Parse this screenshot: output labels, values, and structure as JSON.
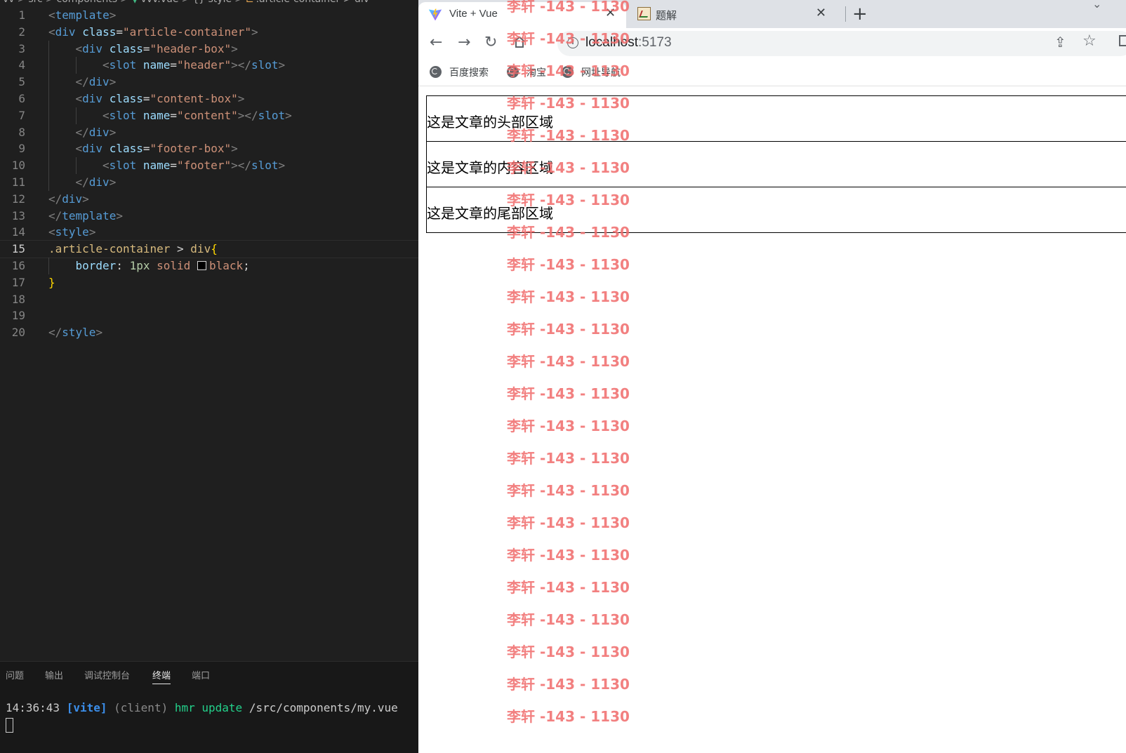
{
  "editor": {
    "breadcrumb": [
      "vv",
      "src",
      "components",
      "vvv.vue",
      "{} style",
      ".article-container > div"
    ],
    "lines": [
      {
        "n": "1",
        "indent": 0,
        "tokens": [
          [
            "t-brk",
            "<"
          ],
          [
            "t-tag",
            "template"
          ],
          [
            "t-brk",
            ">"
          ]
        ]
      },
      {
        "n": "2",
        "indent": 0,
        "tokens": [
          [
            "t-brk",
            "<"
          ],
          [
            "t-tag",
            "div"
          ],
          [
            "t-plain",
            " "
          ],
          [
            "t-attr",
            "class"
          ],
          [
            "t-plain",
            "="
          ],
          [
            "t-str",
            "\"article-container\""
          ],
          [
            "t-brk",
            ">"
          ]
        ]
      },
      {
        "n": "3",
        "indent": 1,
        "tokens": [
          [
            "t-brk",
            "<"
          ],
          [
            "t-tag",
            "div"
          ],
          [
            "t-plain",
            " "
          ],
          [
            "t-attr",
            "class"
          ],
          [
            "t-plain",
            "="
          ],
          [
            "t-str",
            "\"header-box\""
          ],
          [
            "t-brk",
            ">"
          ]
        ]
      },
      {
        "n": "4",
        "indent": 2,
        "tokens": [
          [
            "t-brk",
            "<"
          ],
          [
            "t-tag",
            "slot"
          ],
          [
            "t-plain",
            " "
          ],
          [
            "t-attr",
            "name"
          ],
          [
            "t-plain",
            "="
          ],
          [
            "t-str",
            "\"header\""
          ],
          [
            "t-brk",
            "></"
          ],
          [
            "t-tag",
            "slot"
          ],
          [
            "t-brk",
            ">"
          ]
        ]
      },
      {
        "n": "5",
        "indent": 1,
        "tokens": [
          [
            "t-brk",
            "</"
          ],
          [
            "t-tag",
            "div"
          ],
          [
            "t-brk",
            ">"
          ]
        ]
      },
      {
        "n": "6",
        "indent": 1,
        "tokens": [
          [
            "t-brk",
            "<"
          ],
          [
            "t-tag",
            "div"
          ],
          [
            "t-plain",
            " "
          ],
          [
            "t-attr",
            "class"
          ],
          [
            "t-plain",
            "="
          ],
          [
            "t-str",
            "\"content-box\""
          ],
          [
            "t-brk",
            ">"
          ]
        ]
      },
      {
        "n": "7",
        "indent": 2,
        "tokens": [
          [
            "t-brk",
            "<"
          ],
          [
            "t-tag",
            "slot"
          ],
          [
            "t-plain",
            " "
          ],
          [
            "t-attr",
            "name"
          ],
          [
            "t-plain",
            "="
          ],
          [
            "t-str",
            "\"content\""
          ],
          [
            "t-brk",
            "></"
          ],
          [
            "t-tag",
            "slot"
          ],
          [
            "t-brk",
            ">"
          ]
        ]
      },
      {
        "n": "8",
        "indent": 1,
        "tokens": [
          [
            "t-brk",
            "</"
          ],
          [
            "t-tag",
            "div"
          ],
          [
            "t-brk",
            ">"
          ]
        ]
      },
      {
        "n": "9",
        "indent": 1,
        "tokens": [
          [
            "t-brk",
            "<"
          ],
          [
            "t-tag",
            "div"
          ],
          [
            "t-plain",
            " "
          ],
          [
            "t-attr",
            "class"
          ],
          [
            "t-plain",
            "="
          ],
          [
            "t-str",
            "\"footer-box\""
          ],
          [
            "t-brk",
            ">"
          ]
        ]
      },
      {
        "n": "10",
        "indent": 2,
        "tokens": [
          [
            "t-brk",
            "<"
          ],
          [
            "t-tag",
            "slot"
          ],
          [
            "t-plain",
            " "
          ],
          [
            "t-attr",
            "name"
          ],
          [
            "t-plain",
            "="
          ],
          [
            "t-str",
            "\"footer\""
          ],
          [
            "t-brk",
            "></"
          ],
          [
            "t-tag",
            "slot"
          ],
          [
            "t-brk",
            ">"
          ]
        ]
      },
      {
        "n": "11",
        "indent": 1,
        "tokens": [
          [
            "t-brk",
            "</"
          ],
          [
            "t-tag",
            "div"
          ],
          [
            "t-brk",
            ">"
          ]
        ]
      },
      {
        "n": "12",
        "indent": 0,
        "tokens": [
          [
            "t-brk",
            "</"
          ],
          [
            "t-tag",
            "div"
          ],
          [
            "t-brk",
            ">"
          ]
        ]
      },
      {
        "n": "13",
        "indent": 0,
        "tokens": [
          [
            "t-brk",
            "</"
          ],
          [
            "t-tag",
            "template"
          ],
          [
            "t-brk",
            ">"
          ]
        ]
      },
      {
        "n": "14",
        "indent": 0,
        "tokens": [
          [
            "t-brk",
            "<"
          ],
          [
            "t-tag",
            "style"
          ],
          [
            "t-brk",
            ">"
          ]
        ]
      },
      {
        "n": "15",
        "indent": 0,
        "active": true,
        "tokens": [
          [
            "t-sel",
            ".article-container"
          ],
          [
            "t-plain",
            " > "
          ],
          [
            "t-sel",
            "div"
          ],
          [
            "t-brace",
            "{"
          ]
        ]
      },
      {
        "n": "16",
        "indent": 1,
        "tokens": [
          [
            "t-prop",
            "border"
          ],
          [
            "t-plain",
            ": "
          ],
          [
            "t-num",
            "1px"
          ],
          [
            "t-plain",
            " "
          ],
          [
            "t-val",
            "solid"
          ],
          [
            "t-plain",
            " "
          ],
          [
            "swatch",
            ""
          ],
          [
            "t-val",
            "black"
          ],
          [
            "t-plain",
            ";"
          ]
        ]
      },
      {
        "n": "17",
        "indent": 0,
        "tokens": [
          [
            "t-brace",
            "}"
          ]
        ]
      },
      {
        "n": "18",
        "indent": 0,
        "tokens": []
      },
      {
        "n": "19",
        "indent": 0,
        "tokens": []
      },
      {
        "n": "20",
        "indent": 0,
        "tokens": [
          [
            "t-brk",
            "</"
          ],
          [
            "t-tag",
            "style"
          ],
          [
            "t-brk",
            ">"
          ]
        ]
      }
    ],
    "panel_tabs": [
      {
        "label": "问题",
        "active": false
      },
      {
        "label": "输出",
        "active": false
      },
      {
        "label": "调试控制台",
        "active": false
      },
      {
        "label": "终端",
        "active": true
      },
      {
        "label": "端口",
        "active": false
      }
    ],
    "terminal": {
      "time": "14:36:43",
      "tag": "[vite]",
      "client": "(client)",
      "hmr": "hmr update",
      "path": "/src/components/my.vue"
    }
  },
  "browser": {
    "tabs": [
      {
        "title": "Vite + Vue",
        "active": true,
        "icon": "vite-icon"
      },
      {
        "title": "题解",
        "active": false,
        "icon": "image-icon"
      }
    ],
    "url": {
      "host": "localhost",
      "port": ":5173"
    },
    "bookmarks": [
      "百度搜索",
      "淘宝",
      "网址导航"
    ],
    "page": {
      "header_text": "这是文章的头部区域",
      "content_text": "这是文章的内容区域",
      "footer_text": "这是文章的尾部区域"
    },
    "watermark_text": "李轩 -143 - 1130"
  },
  "colors": {
    "editor_bg": "#1f1f1f",
    "watermark": "#f06b6b",
    "tab_strip": "#dee1e6"
  }
}
